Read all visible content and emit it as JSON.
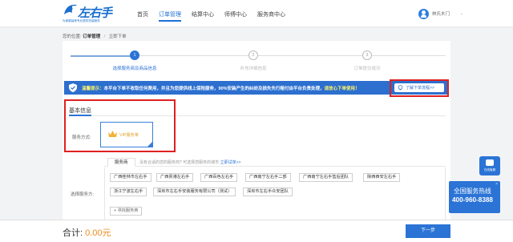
{
  "header": {
    "logo_text": "左右手",
    "logo_sub": "LeftRight Hand",
    "logo_tagline": "为家庭装修专业提供安装服务",
    "nav": [
      {
        "label": "首页",
        "active": false
      },
      {
        "label": "订单管理",
        "active": true
      },
      {
        "label": "结算中心",
        "active": false
      },
      {
        "label": "师傅中心",
        "active": false
      },
      {
        "label": "服务商中心",
        "active": false
      }
    ],
    "user_name": "林氏木门",
    "user_caret": "⌄"
  },
  "breadcrumb": {
    "prefix": "您的位置:",
    "level1": "订单管理",
    "separator": "/",
    "level2": "立即下单"
  },
  "steps": [
    {
      "number": "1",
      "label": "选择服务商及商品信息",
      "active": true
    },
    {
      "number": "2",
      "label": "补充详细信息",
      "active": false
    },
    {
      "number": "3",
      "label": "订单提交成功",
      "active": false
    }
  ],
  "banner": {
    "prefix": "温馨提示：",
    "text": "本平台下单不收取任何费用，并且为您提供线上保险服务，90%安装产生的纠纷及损失先行赔付由平台负责处理，",
    "highlight": "请放心下单使用！",
    "flow_button": "了解下单流程>>",
    "color": "#2c6fcf"
  },
  "basic_info": {
    "title": "基本信息",
    "order_type_label": "服务方式:",
    "vip_option": "VIP服务单",
    "service_label": "选择服务方:",
    "service_tab": "服务商",
    "service_hint": "没有合适的您的服务商? 可选择您服务的城市",
    "service_hint_link": "立即试单>>",
    "providers": [
      "广西桂林市左右手",
      "广西贵港左右手",
      "广西百色左右手",
      "广西南宁左右手二部",
      "广西南宁左右手售后团队",
      "陕西西安左右手",
      "浙江宁波左右手",
      "深圳市左右手安装服务有限公司（测试）",
      "深圳市左右手众安团队"
    ],
    "more_button": "+ 寻找服务商"
  },
  "footer": {
    "total_label": "合计:",
    "total_amount": "0.00元",
    "next_button": "下一步"
  },
  "side": {
    "chat_label": "在线客服",
    "hotline_title": "全国服务热线",
    "hotline_number": "400-960-8388",
    "close": "×"
  },
  "colors": {
    "primary": "#2b74d6",
    "highlight_box": "#e02020",
    "amount": "#f08a1e"
  }
}
